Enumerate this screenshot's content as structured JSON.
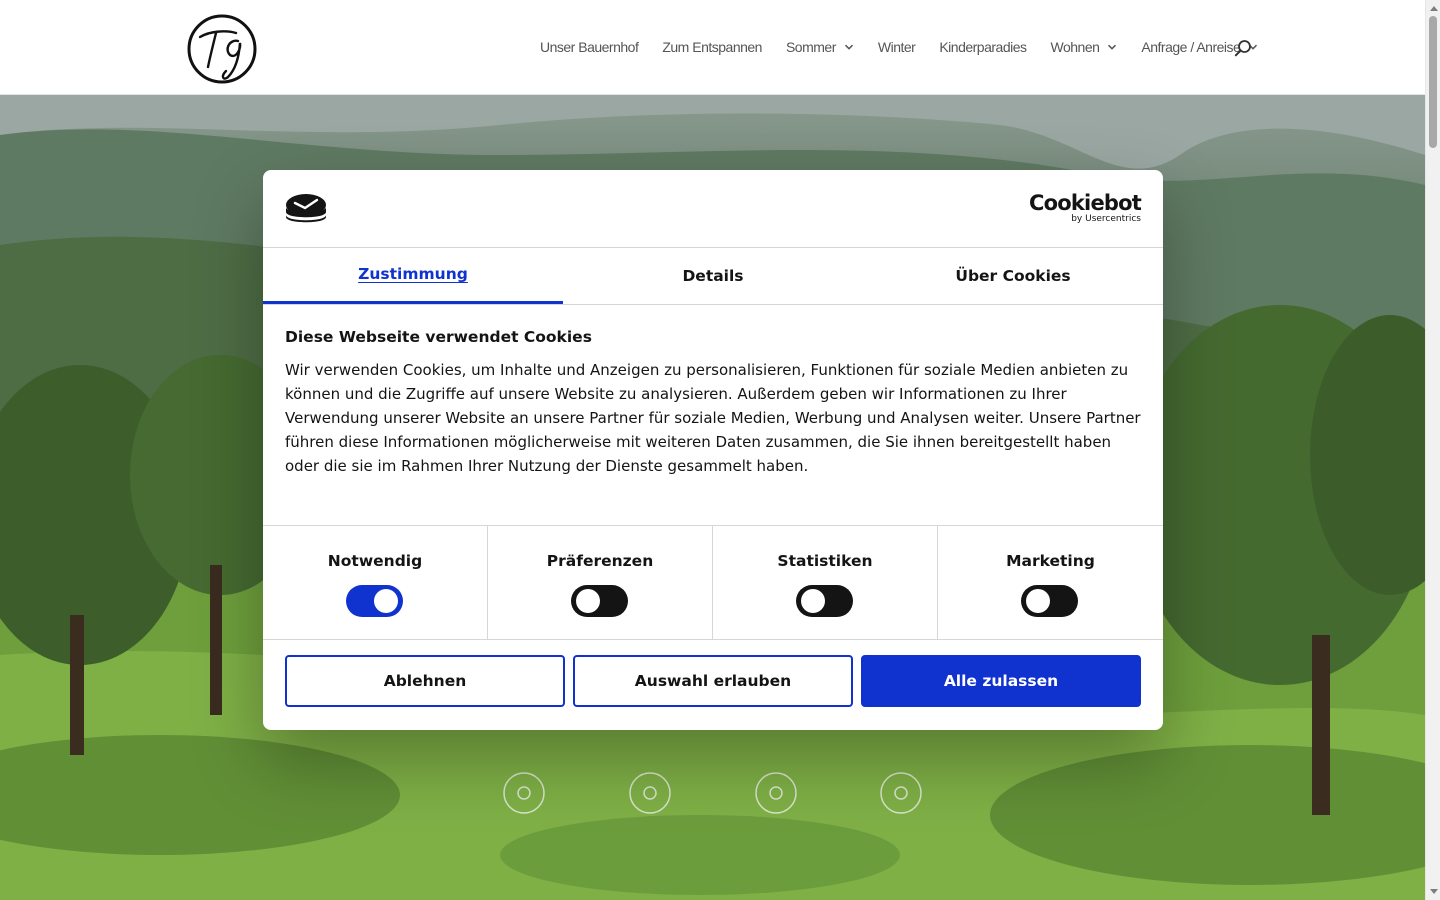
{
  "header": {
    "logo_alt": "TG",
    "nav": [
      {
        "label": "Unser Bauernhof",
        "dropdown": false
      },
      {
        "label": "Zum Entspannen",
        "dropdown": false
      },
      {
        "label": "Sommer",
        "dropdown": true
      },
      {
        "label": "Winter",
        "dropdown": false
      },
      {
        "label": "Kinderparadies",
        "dropdown": false
      },
      {
        "label": "Wohnen",
        "dropdown": true
      },
      {
        "label": "Anfrage / Anreise",
        "dropdown": true
      }
    ],
    "search_icon": "search-icon"
  },
  "dialog": {
    "brand": {
      "name": "Cookiebot",
      "sub": "by Usercentrics"
    },
    "tabs": [
      {
        "label": "Zustimmung",
        "active": true
      },
      {
        "label": "Details",
        "active": false
      },
      {
        "label": "Über Cookies",
        "active": false
      }
    ],
    "title": "Diese Webseite verwendet Cookies",
    "text": "Wir verwenden Cookies, um Inhalte und Anzeigen zu personalisieren, Funktionen für soziale Medien anbieten zu können und die Zugriffe auf unsere Website zu analysieren. Außerdem geben wir Informationen zu Ihrer Verwendung unserer Website an unsere Partner für soziale Medien, Werbung und Analysen weiter. Unsere Partner führen diese Informationen möglicherweise mit weiteren Daten zusammen, die Sie ihnen bereitgestellt haben oder die sie im Rahmen Ihrer Nutzung der Dienste gesammelt haben.",
    "categories": [
      {
        "label": "Notwendig",
        "enabled": true
      },
      {
        "label": "Präferenzen",
        "enabled": false
      },
      {
        "label": "Statistiken",
        "enabled": false
      },
      {
        "label": "Marketing",
        "enabled": false
      }
    ],
    "buttons": {
      "reject": "Ablehnen",
      "allow_selection": "Auswahl erlauben",
      "allow_all": "Alle zulassen"
    }
  },
  "colors": {
    "accent": "#1032cf",
    "text": "#141414",
    "nav_text": "#555555"
  }
}
